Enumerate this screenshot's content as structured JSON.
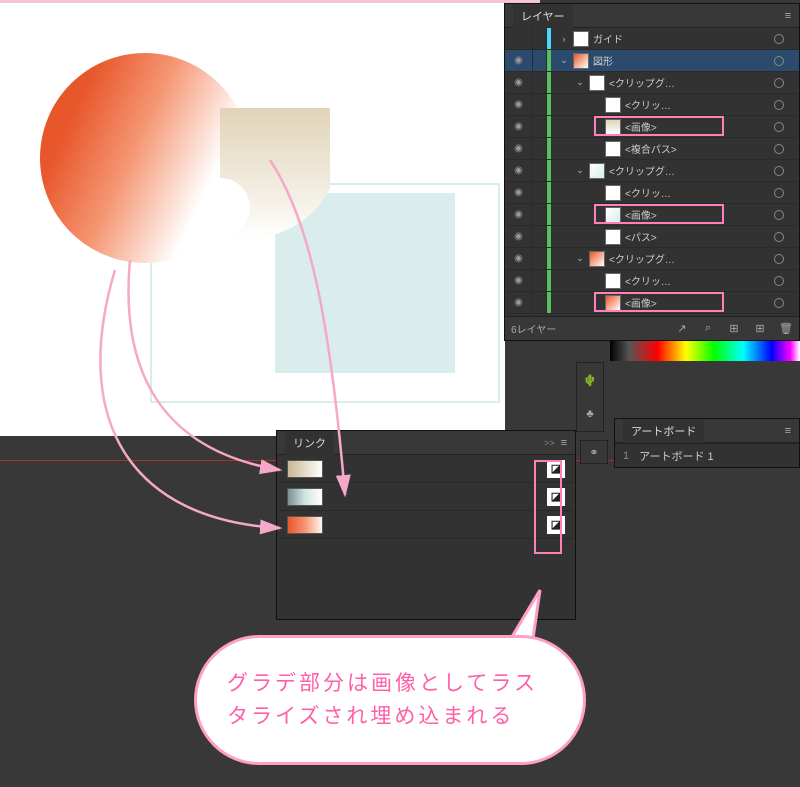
{
  "layers_panel": {
    "title": "レイヤー",
    "footer_label": "6レイヤー",
    "rows": [
      {
        "name": "ガイド",
        "indent": 0,
        "color": "#4ad8ff",
        "thumb": "white",
        "disclosure": ">",
        "selected": false,
        "eye": false
      },
      {
        "name": "図形",
        "indent": 0,
        "color": "#58c060",
        "thumb": "grad-orange",
        "disclosure": "v",
        "selected": true,
        "eye": true
      },
      {
        "name": "<クリップグ…",
        "indent": 1,
        "color": "#58c060",
        "thumb": "white",
        "disclosure": "v",
        "selected": false,
        "eye": true
      },
      {
        "name": "<クリッ…",
        "indent": 2,
        "color": "#58c060",
        "thumb": "white",
        "disclosure": "",
        "selected": false,
        "eye": true
      },
      {
        "name": "<画像>",
        "indent": 2,
        "color": "#58c060",
        "thumb": "grad-tan",
        "disclosure": "",
        "selected": false,
        "eye": true,
        "highlight": true
      },
      {
        "name": "<複合パス>",
        "indent": 2,
        "color": "#58c060",
        "thumb": "white",
        "disclosure": "",
        "selected": false,
        "eye": true
      },
      {
        "name": "<クリップグ…",
        "indent": 1,
        "color": "#58c060",
        "thumb": "grad-teal",
        "disclosure": "v",
        "selected": false,
        "eye": true
      },
      {
        "name": "<クリッ…",
        "indent": 2,
        "color": "#58c060",
        "thumb": "white",
        "disclosure": "",
        "selected": false,
        "eye": true
      },
      {
        "name": "<画像>",
        "indent": 2,
        "color": "#58c060",
        "thumb": "grad-teal",
        "disclosure": "",
        "selected": false,
        "eye": true,
        "highlight": true
      },
      {
        "name": "<パス>",
        "indent": 2,
        "color": "#58c060",
        "thumb": "white",
        "disclosure": "",
        "selected": false,
        "eye": true
      },
      {
        "name": "<クリップグ…",
        "indent": 1,
        "color": "#58c060",
        "thumb": "grad-orange",
        "disclosure": "v",
        "selected": false,
        "eye": true
      },
      {
        "name": "<クリッ…",
        "indent": 2,
        "color": "#58c060",
        "thumb": "white",
        "disclosure": "",
        "selected": false,
        "eye": true
      },
      {
        "name": "<画像>",
        "indent": 2,
        "color": "#58c060",
        "thumb": "grad-orange",
        "disclosure": "",
        "selected": false,
        "eye": true,
        "highlight": true
      }
    ]
  },
  "links_panel": {
    "title": "リンク",
    "rows": [
      {
        "thumb": "tan"
      },
      {
        "thumb": "teal"
      },
      {
        "thumb": "orange"
      }
    ]
  },
  "artboard_panel": {
    "title": "アートボード",
    "rows": [
      {
        "num": "1",
        "name": "アートボード 1"
      }
    ]
  },
  "bubble": {
    "text": "グラデ部分は画像としてラスタライズされ埋め込まれる"
  },
  "icons": {
    "eye": "◉",
    "menu": "≡",
    "export": "↗",
    "find": "⌕",
    "new_sub": "⊞",
    "new": "⊞",
    "trash": "🗑",
    "chain": "⚭",
    "cactus": "🌵",
    "club": "♣",
    "embed": "◪"
  }
}
